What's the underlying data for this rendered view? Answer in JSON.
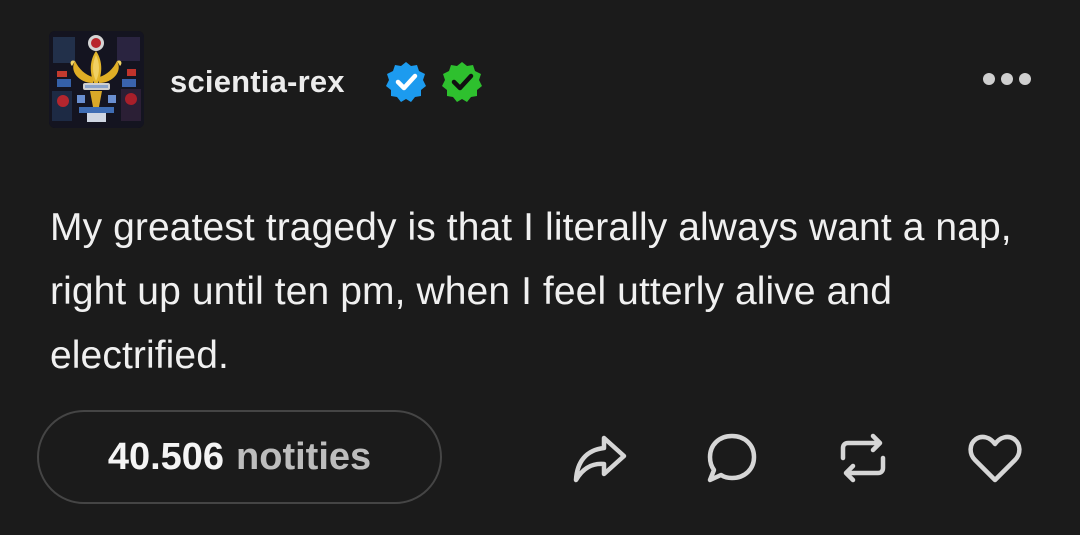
{
  "post": {
    "author": {
      "username": "scientia-rex",
      "avatar_icon": "stained-glass-fleur-de-lis-avatar",
      "badges": [
        {
          "icon": "verified-badge-icon",
          "color": "#1c9bef"
        },
        {
          "icon": "verified-badge-icon",
          "color": "#2ec02e"
        }
      ]
    },
    "more_icon": "ellipsis-icon",
    "text": "My greatest tragedy is that I literally always want a nap, right up until ten pm, when I feel utterly alive and electrified.",
    "notes": {
      "count": "40.506",
      "label": "notities"
    },
    "actions": [
      {
        "icon": "share-icon"
      },
      {
        "icon": "reply-icon"
      },
      {
        "icon": "reblog-icon"
      },
      {
        "icon": "like-icon"
      }
    ]
  },
  "colors": {
    "background": "#1b1b1b",
    "text": "#f0f0f0",
    "muted": "#bdbdbd",
    "pill_border": "#454545"
  }
}
